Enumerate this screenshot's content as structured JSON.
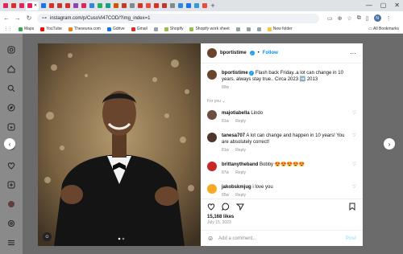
{
  "browser": {
    "tab_icons": [
      "#e0245e",
      "#d93025",
      "#e0245e",
      "#e0245e",
      "#1a73e8",
      "#d93025",
      "#c0392b",
      "#d93025",
      "#8e44ad",
      "#e0245e",
      "#2e86de",
      "#27ae60",
      "#16a085",
      "#d35400",
      "#c0392b",
      "#7f8c8d",
      "#d93025",
      "#e74c3c",
      "#d93025",
      "#c0392b",
      "#7f8c8d",
      "#2e86de",
      "#1a73e8",
      "#3498db",
      "#e74c3c"
    ],
    "active_tab_close": "✕",
    "new_tab": "+",
    "url": "instagram.com/p/CusoVi47COD/?img_index=1",
    "profile_initial": "N"
  },
  "bookmarks": [
    {
      "label": "Maps",
      "color": "#34a853"
    },
    {
      "label": "YouTube",
      "color": "#ff0000"
    },
    {
      "label": "Theseuna.com",
      "color": "#e67e22"
    },
    {
      "label": "Gdrive",
      "color": "#1a73e8"
    },
    {
      "label": "Gmail",
      "color": "#d93025"
    },
    {
      "label": "",
      "color": "#95a5a6"
    },
    {
      "label": "Shopify",
      "color": "#96bf48"
    },
    {
      "label": "Shopify work sheet",
      "color": "#96bf48"
    },
    {
      "label": "",
      "color": "#95a5a6"
    },
    {
      "label": "",
      "color": "#95a5a6"
    },
    {
      "label": "",
      "color": "#95a5a6"
    },
    {
      "label": "New folder",
      "color": "#f5c542"
    }
  ],
  "all_bookmarks": "All Bookmarks",
  "post": {
    "username": "bportistime",
    "follow": "Follow",
    "more": "···",
    "caption": "Flash back Friday..a lot can change in 10 years. always stay true.. Circa 2023 ➡️ 2013",
    "caption_time": "89w",
    "for_you": "For you",
    "comments": [
      {
        "user": "majotiabella",
        "text": "Lindo",
        "time": "81w",
        "reply": "Reply",
        "avatar": "#6d4c41"
      },
      {
        "user": "tanesa707",
        "text": "A lot can change and happen in 10 years! You are absolutely correct!",
        "time": "81w",
        "reply": "Reply",
        "avatar": "#4e342e"
      },
      {
        "user": "brittanytheband",
        "text": "Bobby 😍😍😍😍😍",
        "time": "87w",
        "reply": "Reply",
        "avatar": "#c62828"
      },
      {
        "user": "jakobskmjug",
        "text": "i love you",
        "time": "85w",
        "reply": "Reply",
        "avatar": "#f9a825"
      }
    ],
    "likes": "15,168 likes",
    "date": "July 15, 2023",
    "add_comment_placeholder": "Add a comment...",
    "post_button": "Post"
  }
}
